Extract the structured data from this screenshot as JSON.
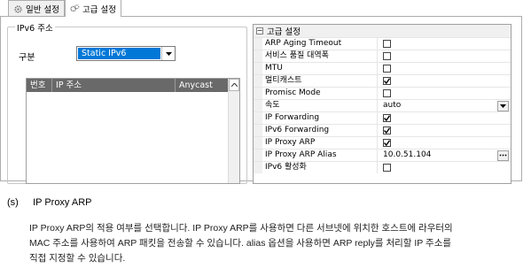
{
  "tabs": [
    {
      "label": "일반 설정",
      "icon": "gear-icon",
      "active": false
    },
    {
      "label": "고급 설정",
      "icon": "gears-icon",
      "active": true
    }
  ],
  "ipv6_group": {
    "title": "IPv6 주소",
    "type_label": "구분",
    "type_value": "Static IPv6",
    "columns": [
      "번호",
      "IP 주소",
      "Anycast"
    ]
  },
  "advanced": {
    "category": "고급 설정",
    "rows": [
      {
        "name": "ARP Aging Timeout",
        "type": "checkbox",
        "checked": false
      },
      {
        "name": "서비스 품질 대역폭",
        "type": "checkbox",
        "checked": false
      },
      {
        "name": "MTU",
        "type": "checkbox",
        "checked": false
      },
      {
        "name": "멀티캐스트",
        "type": "checkbox",
        "checked": true
      },
      {
        "name": "Promisc Mode",
        "type": "checkbox",
        "checked": false
      },
      {
        "name": "속도",
        "type": "dropdown",
        "value": "auto"
      },
      {
        "name": "IP Forwarding",
        "type": "checkbox",
        "checked": true
      },
      {
        "name": "IPv6 Forwarding",
        "type": "checkbox",
        "checked": true
      },
      {
        "name": "IP Proxy ARP",
        "type": "checkbox",
        "checked": true
      },
      {
        "name": "IP Proxy ARP Alias",
        "type": "text-ellipsis",
        "value": "10.0.51.104"
      },
      {
        "name": "IPv6 활성화",
        "type": "checkbox",
        "checked": false
      }
    ]
  },
  "doc": {
    "section_number": "(s)",
    "section_title": "IP Proxy ARP",
    "lines": [
      "IP Proxy ARP의 적용 여부를 선택합니다. IP Proxy ARP를 사용하면 다른 서브넷에 위치한 호스트에 라우터의",
      "MAC 주소를 사용하여 ARP 패킷을 전송할 수 있습니다. alias 옵션을 사용하면 ARP reply를 처리할 IP 주소를",
      "직접 지정할 수 있습니다."
    ]
  }
}
